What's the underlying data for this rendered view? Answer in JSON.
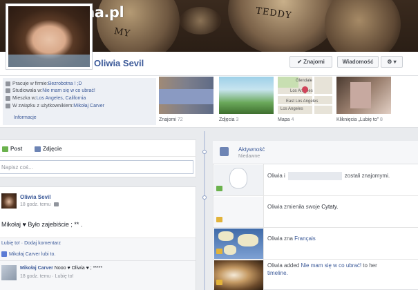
{
  "watermark": "www.wiocha.pl",
  "cover": {
    "text_1": "MY",
    "text_2": "TEDDY"
  },
  "profile": {
    "name": "Oliwia Sevil",
    "buttons": {
      "friends": "✔ Znajomi",
      "message": "Wiadomość",
      "gear": "⚙ ▾"
    }
  },
  "info": {
    "work": {
      "prefix": "Pracuje w firmie: ",
      "value": "Bezrobotna ! ;D"
    },
    "study": {
      "prefix": "Studiowała w: ",
      "value": "Nie mam się w co ubrać!"
    },
    "lives": {
      "prefix": "Mieszka w: ",
      "value": "Los Angeles, California"
    },
    "relation": {
      "prefix": "W związku z użytkownikiem: ",
      "value": "Mikołaj Carver"
    },
    "link": "Informacje"
  },
  "thumbs": [
    {
      "label": "Znajomi",
      "count": "72"
    },
    {
      "label": "Zdjęcia",
      "count": "3"
    },
    {
      "label": "Mapa",
      "count": "4"
    },
    {
      "label": "Kliknięcia „Lubię to”",
      "count": "8"
    }
  ],
  "map_labels": [
    "Glendale",
    "Los Angeles",
    "East Los Angeles",
    "Los Angeles"
  ],
  "composer": {
    "tab_post": "Post",
    "tab_photo": "Zdjęcie",
    "placeholder": "Napisz coś..."
  },
  "post": {
    "author": "Oliwia Sevil",
    "time": "18 godz. temu",
    "text": "Mikołaj ♥ Było zajebiście ; ** .",
    "actions": "Lubię to! · Dodaj komentarz",
    "likes": "Mikołaj Carver lubi to.",
    "comment": {
      "author": "Mikołaj Carver",
      "text": " Nooo ♥ Oliwia ♥ ; *****",
      "meta": "18 godz. temu · Lubię to!"
    }
  },
  "activity": {
    "title": "Aktywność",
    "subtitle": "Niedawne",
    "items": [
      {
        "before": "Oliwia i",
        "after": "zostali znajomymi."
      },
      {
        "before": "Oliwia zmieniła swoje ",
        "link": "Cytaty",
        "after": "."
      },
      {
        "before": "Oliwia zna ",
        "link": "Français",
        "after": ""
      },
      {
        "before": "Oliwia added ",
        "link": "Nie mam się w co ubrać!",
        "after": " to her",
        "line2": "timeline."
      }
    ]
  },
  "colors": {
    "link": "#3b5998",
    "background": "#e9ebee",
    "spine": "#c4cde0"
  }
}
